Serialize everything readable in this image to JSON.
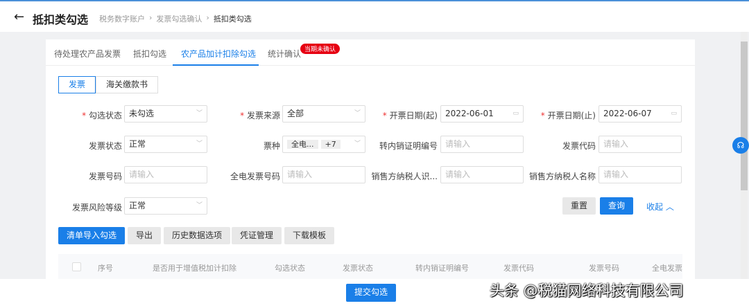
{
  "header": {
    "title": "抵扣类勾选",
    "breadcrumb": [
      "税务数字账户",
      "发票勾选确认",
      "抵扣类勾选"
    ]
  },
  "tabs": [
    {
      "label": "待处理农产品发票"
    },
    {
      "label": "抵扣勾选"
    },
    {
      "label": "农产品加计扣除勾选",
      "active": true
    },
    {
      "label": "统计确认"
    }
  ],
  "tab_badge": "当期未确认",
  "segment": [
    "发票",
    "海关缴款书"
  ],
  "form": {
    "gxzt": {
      "label": "勾选状态",
      "value": "未勾选"
    },
    "fply": {
      "label": "发票来源",
      "value": "全部"
    },
    "kprq_start": {
      "label": "开票日期(起)",
      "value": "2022-06-01"
    },
    "kprq_end": {
      "label": "开票日期(止)",
      "value": "2022-06-07"
    },
    "fpzt": {
      "label": "发票状态",
      "value": "正常"
    },
    "pz": {
      "label": "票种",
      "tag1": "全电...",
      "tag2": "+7"
    },
    "znxzm": {
      "label": "转内销证明编号",
      "placeholder": "请输入"
    },
    "fpdm": {
      "label": "发票代码",
      "placeholder": "请输入"
    },
    "fphm": {
      "label": "发票号码",
      "placeholder": "请输入"
    },
    "qdfphm": {
      "label": "全电发票号码",
      "placeholder": "请输入"
    },
    "xsfsbh": {
      "label": "销售方纳税人识...",
      "placeholder": "请输入"
    },
    "xsfmc": {
      "label": "销售方纳税人名称",
      "placeholder": "请输入"
    },
    "fxdj": {
      "label": "发票风险等级",
      "value": "正常"
    }
  },
  "buttons": {
    "reset": "重置",
    "query": "查询",
    "collapse": "收起",
    "import": "清单导入勾选",
    "export": "导出",
    "history": "历史数据选项",
    "voucher": "凭证管理",
    "template": "下载模板",
    "submit": "提交勾选"
  },
  "table": {
    "columns": [
      "序号",
      "是否用于增值税加计扣除",
      "勾选状态",
      "发票状态",
      "转内销证明编号",
      "发票代码",
      "发票号码",
      "全电发票"
    ]
  },
  "watermark": "头条 @税猫网络科技有限公司",
  "colors": {
    "primary": "#1a7fe8",
    "badge": "#e60012"
  }
}
